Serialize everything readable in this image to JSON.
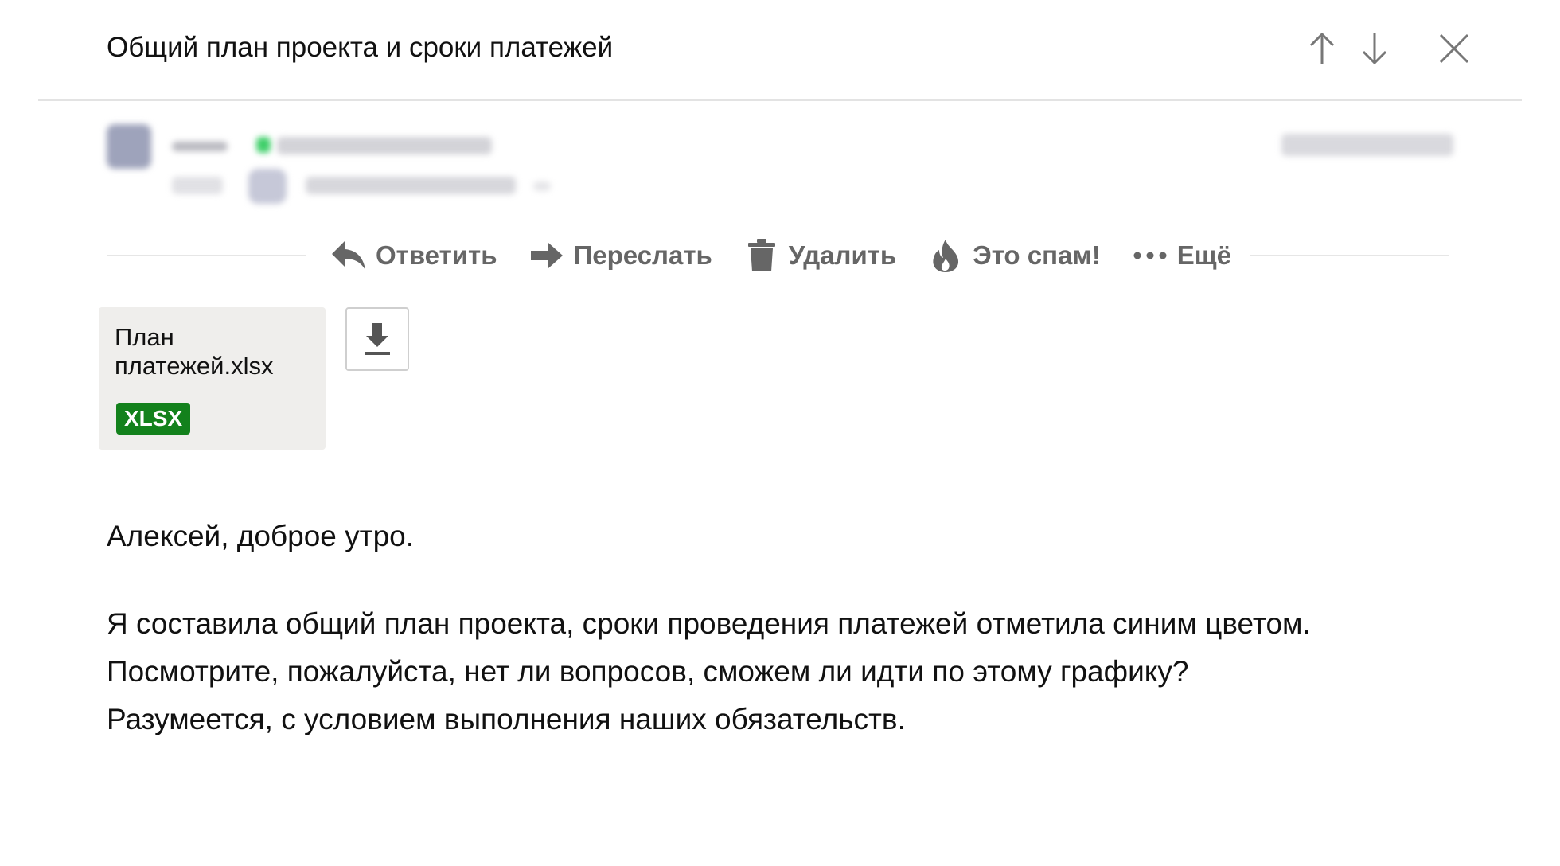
{
  "header": {
    "subject": "Общий план проекта и сроки платежей"
  },
  "toolbar": {
    "reply_label": "Ответить",
    "forward_label": "Переслать",
    "delete_label": "Удалить",
    "spam_label": "Это спам!",
    "more_label": "Ещё"
  },
  "attachment": {
    "file_name": "План платежей.xlsx",
    "badge": "XLSX",
    "badge_color": "#13811c"
  },
  "message": {
    "greeting": "Алексей, доброе утро.",
    "lines": [
      "Я составила общий план проекта, сроки проведения платежей отметила синим цветом.",
      "Посмотрите, пожалуйста, нет ли вопросов, сможем ли идти по этому графику?",
      "Разумеется, с условием выполнения наших обязательств."
    ]
  },
  "icons": {
    "prev": "arrow-up-icon",
    "next": "arrow-down-icon",
    "close": "close-icon",
    "reply": "reply-icon",
    "forward": "forward-icon",
    "delete": "trash-icon",
    "spam": "fire-icon",
    "more": "more-dots-icon",
    "download": "download-icon"
  }
}
